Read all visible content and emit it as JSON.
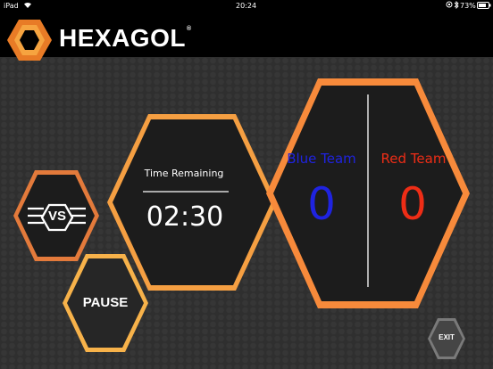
{
  "status_bar": {
    "device": "iPad",
    "time": "20:24",
    "battery": "73%",
    "icons": [
      "wifi-icon",
      "orientation-lock-icon",
      "bluetooth-icon",
      "battery-icon"
    ]
  },
  "app": {
    "name": "HEXAGOL",
    "registered_mark": "®"
  },
  "timer": {
    "label": "Time Remaining",
    "value": "02:30"
  },
  "vs_button": {
    "label": "VS"
  },
  "pause_button": {
    "label": "PAUSE"
  },
  "exit_button": {
    "label": "EXIT"
  },
  "scoreboard": {
    "blue": {
      "name": "Blue Team",
      "score": "0",
      "color": "#1f23e0"
    },
    "red": {
      "name": "Red Team",
      "score": "0",
      "color": "#ee2d16"
    }
  },
  "colors": {
    "accent_orange": "#f58a3a",
    "accent_yellow": "#f7b24a",
    "hex_fill": "#1c1c1c",
    "background": "#2f2f2f"
  }
}
